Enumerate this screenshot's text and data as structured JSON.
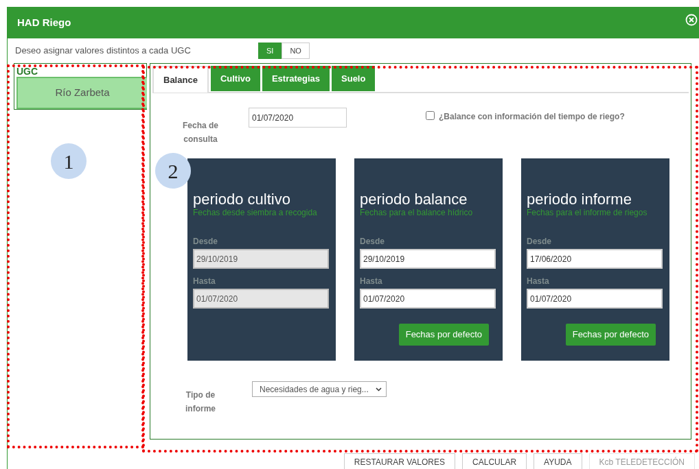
{
  "window": {
    "title": "HAD Riego"
  },
  "assign_toggle": {
    "label": "Deseo asignar valores distintos a cada UGC",
    "options": [
      {
        "label": "SI",
        "selected": true
      },
      {
        "label": "NO",
        "selected": false
      }
    ]
  },
  "ugc_panel": {
    "title": "UGC",
    "items": [
      {
        "label": "Río Zarbeta",
        "selected": true
      }
    ]
  },
  "tabs": [
    {
      "label": "Balance",
      "selected": true
    },
    {
      "label": "Cultivo",
      "selected": false
    },
    {
      "label": "Estrategias",
      "selected": false
    },
    {
      "label": "Suelo",
      "selected": false
    }
  ],
  "balance": {
    "query_date": {
      "label": "Fecha de consulta",
      "value": "01/07/2020"
    },
    "irrigation_time_checkbox": {
      "label": "¿Balance con información del tiempo de riego?",
      "checked": false
    },
    "periods": [
      {
        "title": "periodo cultivo",
        "subtitle": "Fechas desde siembra a recogida",
        "from_label": "Desde",
        "from": "29/10/2019",
        "to_label": "Hasta",
        "to": "01/07/2020",
        "disabled": true
      },
      {
        "title": "periodo balance",
        "subtitle": "Fechas para el balance hídrico",
        "from_label": "Desde",
        "from": "29/10/2019",
        "to_label": "Hasta",
        "to": "01/07/2020",
        "disabled": false,
        "button": "Fechas por defecto"
      },
      {
        "title": "periodo informe",
        "subtitle": "Fechas para el informe de riegos",
        "from_label": "Desde",
        "from": "17/06/2020",
        "to_label": "Hasta",
        "to": "01/07/2020",
        "disabled": false,
        "button": "Fechas por defecto"
      }
    ],
    "report_type": {
      "label": "Tipo de informe",
      "value": "Necesidades de agua y rieg..."
    }
  },
  "footer_buttons": [
    {
      "label": "RESTAURAR VALORES",
      "disabled": false
    },
    {
      "label": "CALCULAR",
      "disabled": false
    },
    {
      "label": "AYUDA",
      "disabled": false
    },
    {
      "label": "Kcb TELEDETECCIÓN",
      "disabled": true
    }
  ],
  "annotations": [
    {
      "label": "1"
    },
    {
      "label": "2"
    }
  ]
}
